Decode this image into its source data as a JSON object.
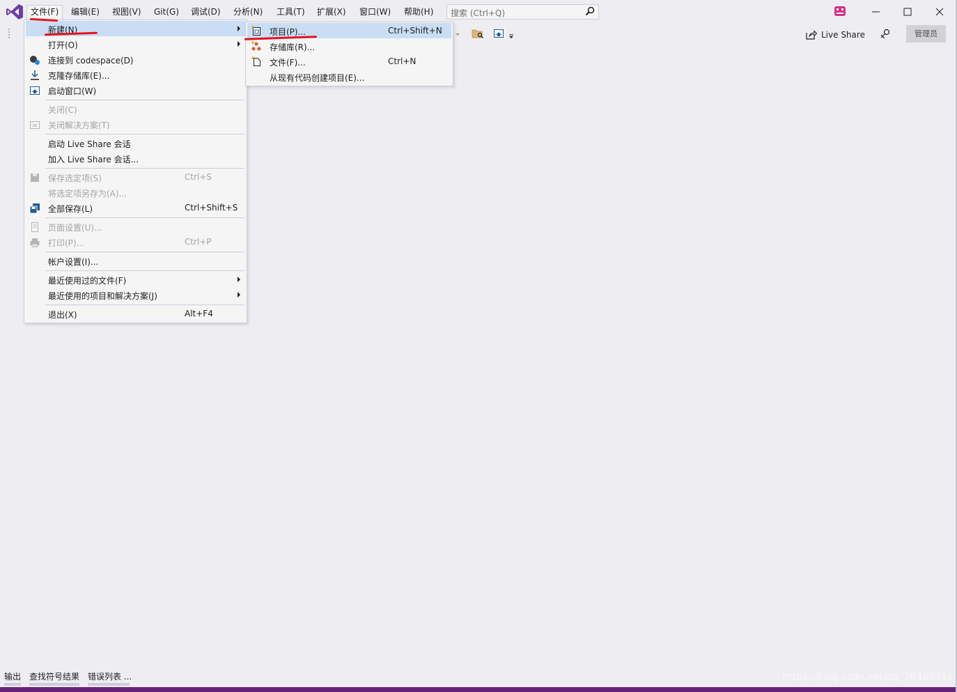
{
  "menubar": {
    "items": [
      "文件(F)",
      "编辑(E)",
      "视图(V)",
      "Git(G)",
      "调试(D)",
      "分析(N)",
      "工具(T)",
      "扩展(X)",
      "窗口(W)",
      "帮助(H)"
    ]
  },
  "search": {
    "placeholder": "搜索 (Ctrl+Q)"
  },
  "toolbar": {
    "liveshare_label": "Live Share",
    "admin_label": "管理员"
  },
  "file_menu": {
    "new": "新建(N)",
    "open": "打开(O)",
    "connect_codespace": "连接到 codespace(D)",
    "clone_repo": "克隆存储库(E)...",
    "start_window": "启动窗口(W)",
    "close": "关闭(C)",
    "close_solution": "关闭解决方案(T)",
    "start_liveshare": "启动 Live Share 会话",
    "join_liveshare": "加入 Live Share 会话...",
    "save_selected": "保存选定项(S)",
    "save_selected_sc": "Ctrl+S",
    "save_as": "将选定项另存为(A)...",
    "save_all": "全部保存(L)",
    "save_all_sc": "Ctrl+Shift+S",
    "page_setup": "页面设置(U)...",
    "print": "打印(P)...",
    "print_sc": "Ctrl+P",
    "account_settings": "帐户设置(I)...",
    "recent_files": "最近使用过的文件(F)",
    "recent_projects": "最近使用的项目和解决方案(J)",
    "exit": "退出(X)",
    "exit_sc": "Alt+F4"
  },
  "new_submenu": {
    "project": "项目(P)...",
    "project_sc": "Ctrl+Shift+N",
    "repository": "存储库(R)...",
    "file": "文件(F)...",
    "file_sc": "Ctrl+N",
    "from_existing": "从现有代码创建项目(E)..."
  },
  "bottom_tabs": [
    "输出",
    "查找符号结果",
    "错误列表 ..."
  ],
  "watermark": "https://blog.csdn.net/qq_38489451",
  "colors": {
    "accent": "#68217a",
    "highlight": "#c9def5",
    "annotation_red": "#e8121e",
    "background": "#eeeef2"
  }
}
